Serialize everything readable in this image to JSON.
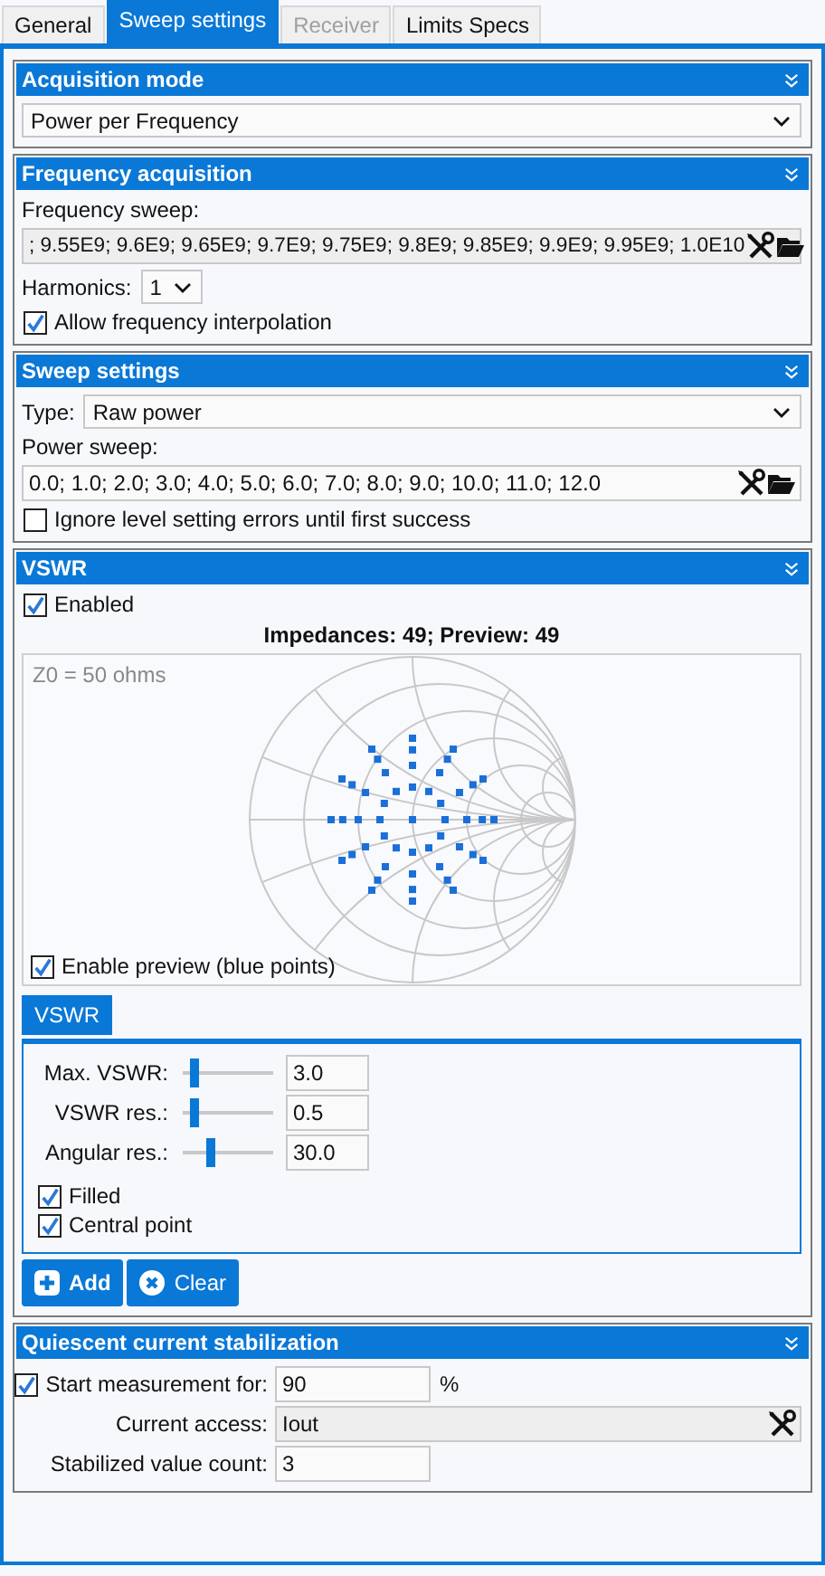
{
  "tabs": [
    {
      "label": "General",
      "selected": false,
      "disabled": false
    },
    {
      "label": "Sweep settings",
      "selected": true,
      "disabled": false
    },
    {
      "label": "Receiver",
      "selected": false,
      "disabled": true
    },
    {
      "label": "Limits Specs",
      "selected": false,
      "disabled": false
    }
  ],
  "acquisition_mode": {
    "title": "Acquisition mode",
    "value": "Power per Frequency"
  },
  "frequency_acquisition": {
    "title": "Frequency acquisition",
    "sweep_label": "Frequency sweep:",
    "sweep_value": "; 9.55E9; 9.6E9; 9.65E9; 9.7E9; 9.75E9; 9.8E9; 9.85E9; 9.9E9; 9.95E9; 1.0E10",
    "harmonics_label": "Harmonics:",
    "harmonics_value": "1",
    "interpolation": {
      "label": "Allow frequency interpolation",
      "checked": true
    }
  },
  "sweep_settings": {
    "title": "Sweep settings",
    "type_label": "Type:",
    "type_value": "Raw power",
    "sweep_label": "Power sweep:",
    "sweep_value": "0.0; 1.0; 2.0; 3.0; 4.0; 5.0; 6.0; 7.0; 8.0; 9.0; 10.0; 11.0; 12.0",
    "ignore_errors": {
      "label": "Ignore level setting errors until first success",
      "checked": false
    }
  },
  "vswr": {
    "title": "VSWR",
    "enabled": {
      "label": "Enabled",
      "checked": true
    },
    "summary": "Impedances: 49; Preview: 49",
    "chart_note": "Z0 = 50 ohms",
    "preview": {
      "label": "Enable preview (blue points)",
      "checked": true
    },
    "subtabs": [
      {
        "label": "VSWR",
        "selected": true
      }
    ],
    "sliders": [
      {
        "label": "Max. VSWR:",
        "level": 0.1,
        "value": "3.0"
      },
      {
        "label": "VSWR res.:",
        "level": 0.1,
        "value": "0.5"
      },
      {
        "label": "Angular res.:",
        "level": 0.3,
        "value": "30.0"
      }
    ],
    "options": [
      {
        "label": "Filled",
        "checked": true
      },
      {
        "label": "Central point",
        "checked": true
      }
    ],
    "buttons": [
      {
        "label": "Add",
        "kind": "add"
      },
      {
        "label": "Clear",
        "kind": "clear"
      }
    ]
  },
  "quiescent": {
    "title": "Quiescent current stabilization",
    "start": {
      "label": "Start measurement for:",
      "checked": true,
      "value": "90",
      "unit": "%"
    },
    "current_access": {
      "label": "Current access:",
      "value": "Iout"
    },
    "count": {
      "label": "Stabilized value count:",
      "value": "3"
    }
  }
}
